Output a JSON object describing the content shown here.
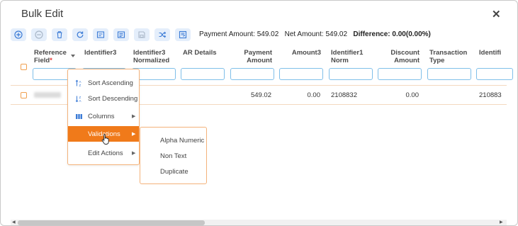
{
  "dialog": {
    "title": "Bulk Edit",
    "close_label": "✕"
  },
  "toolbar": {
    "buttons": [
      "add-icon",
      "remove-icon",
      "delete-icon",
      "refresh-icon",
      "edit-icon",
      "edit-all-icon",
      "save-icon",
      "shuffle-icon",
      "export-icon"
    ],
    "payment_amount": "Payment Amount: 549.02",
    "net_amount": "Net Amount: 549.02",
    "difference": "Difference: 0.00(0.00%)"
  },
  "columns": {
    "c1_line1": "Reference",
    "c1_line2": "Field",
    "c1_required": "*",
    "c2": "Identifier3",
    "c3_line1": "Identifier3",
    "c3_line2": "Normalized",
    "c4": "AR Details",
    "c5_line1": "Payment",
    "c5_line2": "Amount",
    "c6": "Amount3",
    "c7_line1": "Identifier1",
    "c7_line2": "Norm",
    "c8_line1": "Discount",
    "c8_line2": "Amount",
    "c9_line1": "Transaction",
    "c9_line2": "Type",
    "c10": "Identifi"
  },
  "row": {
    "payment_amount": "549.02",
    "amount3": "0.00",
    "identifier1_norm": "2108832",
    "discount_amount": "0.00",
    "identifier": "210883"
  },
  "context_menu": {
    "sort_asc": "Sort Ascending",
    "sort_desc": "Sort Descending",
    "columns": "Columns",
    "validations": "Validations",
    "edit_actions": "Edit Actions"
  },
  "submenu": {
    "alpha_numeric": "Alpha Numeric",
    "non_text": "Non Text",
    "duplicate": "Duplicate"
  },
  "colors": {
    "accent": "#f07a1a",
    "toolbar_bg": "#e4eefb",
    "icon": "#3b7bd6"
  }
}
